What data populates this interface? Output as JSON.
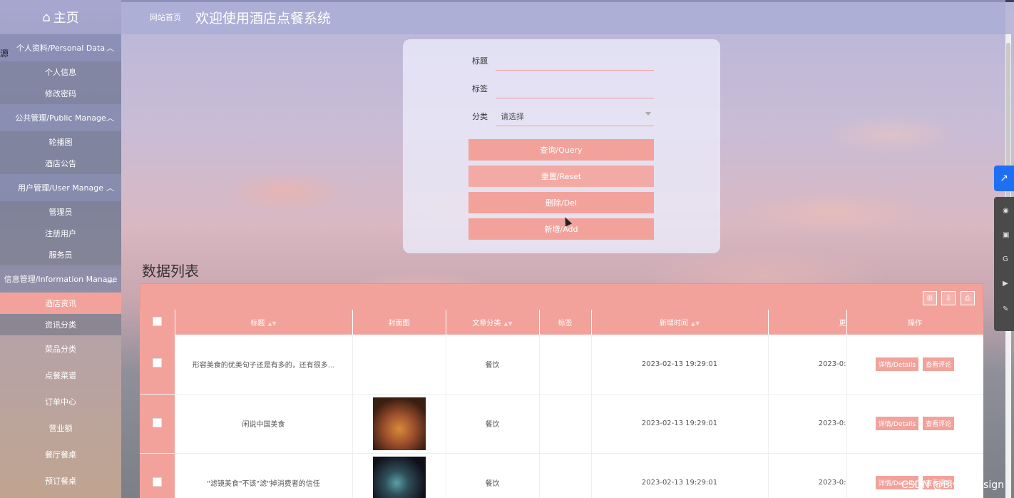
{
  "sidebar": {
    "home_label": "主页",
    "groups": [
      {
        "label": "个人资料/Personal Data",
        "items": [
          "个人信息",
          "修改密码"
        ]
      },
      {
        "label": "公共管理/Public Manage",
        "items": [
          "轮播图",
          "酒店公告"
        ]
      },
      {
        "label": "用户管理/User Manage",
        "items": [
          "管理员",
          "注册用户",
          "服务员"
        ]
      },
      {
        "label": "信息管理/Information Manage",
        "items": [
          "酒店资讯",
          "资讯分类"
        ]
      }
    ],
    "loose_items": [
      "菜品分类",
      "点餐菜谱",
      "订单中心",
      "营业额",
      "餐厅餐桌",
      "预订餐桌"
    ],
    "left_glyph": "源"
  },
  "header": {
    "breadcrumb": "网站首页",
    "title": "欢迎使用酒店点餐系统"
  },
  "search": {
    "title_label": "标题",
    "tag_label": "标签",
    "category_label": "分类",
    "category_value": "请选择",
    "buttons": [
      "查询/Query",
      "重置/Reset",
      "删除/Del",
      "新增/Add"
    ]
  },
  "list": {
    "heading": "数据列表",
    "columns": [
      "标题",
      "封面图",
      "文章分类",
      "标签",
      "新增时间",
      "更",
      "操作"
    ],
    "rows": [
      {
        "title": "形容美食的优美句子还是有多的，还有很多...",
        "category": "餐饮",
        "tag": "",
        "created": "2023-02-13 19:29:01",
        "updated": "2023-0:",
        "details": "详情/Details",
        "comments": "查看评论"
      },
      {
        "title": "闲说中国美食",
        "category": "餐饮",
        "tag": "",
        "created": "2023-02-13 19:29:01",
        "updated": "2023-0:",
        "details": "详情/Details",
        "comments": "查看评论"
      },
      {
        "title": "\"滤镜美食\"不该\"滤\"掉消费者的信任",
        "category": "餐饮",
        "tag": "",
        "created": "2023-02-13 19:29:01",
        "updated": "2023-0:",
        "details": "详情/Details",
        "comments": "查看评论"
      }
    ]
  },
  "watermark": "CSDN @Biye_Design"
}
